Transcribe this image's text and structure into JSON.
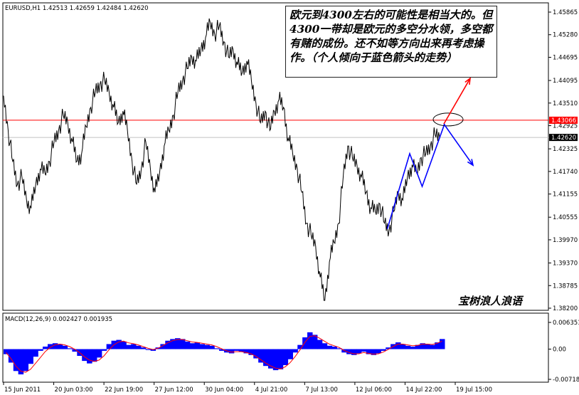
{
  "symbol_header": "EURUSD,H1  1.42513 1.42659 1.42484 1.42620",
  "macd_header": "MACD(12,26,9) 0.002427 0.001935",
  "annotation_text": "欧元到4300左右的可能性是相当大的。但4300一带却是欧元的多空分水领，多空都有赌的成份。还不如等方向出来再考虑操作。（个人倾向于蓝色箭头的走势）",
  "watermark": "宝树浪人浪语",
  "colors": {
    "background": "#ffffff",
    "price_line": "#000000",
    "horizontal_line": "#ff0000",
    "current_price_line": "#c0c0c0",
    "current_price_box": "#000000",
    "macd_histogram": "#0000ff",
    "macd_signal": "#ff0000",
    "arrow_up": "#ff0000",
    "arrow_down": "#0000ff"
  },
  "chart_data": [
    {
      "type": "line",
      "title": "EURUSD,H1",
      "x_tick_labels": [
        "15 Jun 2011",
        "20 Jun 03:00",
        "22 Jun 19:00",
        "27 Jun 12:00",
        "30 Jun 04:00",
        "4 Jul 21:00",
        "7 Jul 13:00",
        "12 Jul 06:00",
        "14 Jul 22:00",
        "19 Jul 15:00"
      ],
      "y_tick_labels": [
        "1.45865",
        "1.45280",
        "1.44695",
        "1.44095",
        "1.43510",
        "1.42925",
        "1.42325",
        "1.41740",
        "1.41155",
        "1.40555",
        "1.39970",
        "1.39370",
        "1.38785",
        "1.38200"
      ],
      "ylim": [
        1.382,
        1.45865
      ],
      "horizontal_line": 1.43066,
      "horizontal_line_label": "1.43066",
      "current_price": 1.4262,
      "current_price_label": "1.42620",
      "series": [
        {
          "values": [
            1.437,
            1.428,
            1.42,
            1.414,
            1.416,
            1.41,
            1.408,
            1.414,
            1.418,
            1.417,
            1.42,
            1.425,
            1.428,
            1.432,
            1.43,
            1.425,
            1.42,
            1.422,
            1.429,
            1.434,
            1.438,
            1.44,
            1.441,
            1.438,
            1.434,
            1.43,
            1.433,
            1.428,
            1.42,
            1.414,
            1.418,
            1.425,
            1.418,
            1.412,
            1.417,
            1.424,
            1.428,
            1.432,
            1.438,
            1.441,
            1.444,
            1.447,
            1.446,
            1.449,
            1.452,
            1.456,
            1.453,
            1.455,
            1.451,
            1.447,
            1.449,
            1.445,
            1.443,
            1.446,
            1.441,
            1.435,
            1.43,
            1.433,
            1.428,
            1.433,
            1.436,
            1.434,
            1.426,
            1.422,
            1.418,
            1.412,
            1.404,
            1.401,
            1.398,
            1.39,
            1.384,
            1.394,
            1.399,
            1.404,
            1.416,
            1.424,
            1.421,
            1.419,
            1.416,
            1.412,
            1.408,
            1.407,
            1.409,
            1.404,
            1.402,
            1.407,
            1.412,
            1.41,
            1.416,
            1.419,
            1.417,
            1.421,
            1.422,
            1.424,
            1.427,
            1.4262
          ]
        }
      ],
      "annotations": {
        "blue_zigzag": [
          [
            1,
            1.4025
          ],
          [
            10,
            1.422
          ],
          [
            15,
            1.4135
          ],
          [
            24,
            1.4297
          ]
        ],
        "red_arrow_target": 1.4415,
        "blue_arrow_target": 1.419,
        "ellipse_level": 1.43066
      }
    },
    {
      "type": "bar",
      "title": "MACD(12,26,9)",
      "y_tick_labels": [
        "0.006351",
        "0.00",
        "-0.00718"
      ],
      "ylim": [
        -0.00718,
        0.006351
      ],
      "series": [
        {
          "name": "MACD",
          "values": [
            -0.0012,
            -0.0032,
            -0.0052,
            -0.006,
            -0.0052,
            -0.0035,
            -0.0018,
            -0.0004,
            0.0006,
            0.0012,
            0.0014,
            0.0012,
            0.0008,
            0.0002,
            -0.0006,
            -0.0016,
            -0.0028,
            -0.0034,
            -0.003,
            -0.002,
            -0.0004,
            0.0012,
            0.002,
            0.0022,
            0.0018,
            0.001,
            0.0012,
            0.0008,
            0.0004,
            -0.0002,
            -0.0004,
            0.0004,
            0.0012,
            0.002,
            0.0024,
            0.0026,
            0.0024,
            0.0018,
            0.0014,
            0.0016,
            0.0012,
            0.001,
            0.0008,
            0.0002,
            -0.0004,
            -0.0008,
            -0.001,
            -0.0004,
            -0.0006,
            -0.001,
            -0.0014,
            -0.0022,
            -0.0032,
            -0.004,
            -0.0046,
            -0.005,
            -0.0048,
            -0.0038,
            -0.0024,
            -0.0008,
            0.001,
            0.0028,
            0.004,
            0.0034,
            0.0022,
            0.0014,
            0.0008,
            0.0006,
            0.0002,
            -0.0008,
            -0.0012,
            -0.0014,
            -0.001,
            -0.0006,
            -0.0012,
            -0.0014,
            -0.001,
            -0.0004,
            0.0004,
            0.0012,
            0.0016,
            0.0012,
            0.0008,
            0.0006,
            0.001,
            0.0014,
            0.0012,
            0.001,
            0.0016,
            0.0024
          ]
        },
        {
          "name": "Signal",
          "values": [
            -0.0008,
            -0.0022,
            -0.004,
            -0.0052,
            -0.0055,
            -0.0048,
            -0.0034,
            -0.002,
            -0.0006,
            0.0004,
            0.001,
            0.0012,
            0.001,
            0.0006,
            0.0,
            -0.0008,
            -0.0018,
            -0.0026,
            -0.0029,
            -0.0026,
            -0.0016,
            -0.0002,
            0.001,
            0.0017,
            0.0019,
            0.0015,
            0.0013,
            0.001,
            0.0006,
            0.0002,
            -0.0001,
            0.0002,
            0.0008,
            0.0015,
            0.002,
            0.0023,
            0.0023,
            0.002,
            0.0017,
            0.0016,
            0.0014,
            0.0012,
            0.001,
            0.0006,
            0.0001,
            -0.0004,
            -0.0007,
            -0.0006,
            -0.0006,
            -0.0008,
            -0.0011,
            -0.0017,
            -0.0025,
            -0.0033,
            -0.004,
            -0.0045,
            -0.0047,
            -0.0042,
            -0.0032,
            -0.0018,
            -0.0002,
            0.0016,
            0.003,
            0.0032,
            0.0026,
            0.0019,
            0.0012,
            0.0008,
            0.0004,
            -0.0003,
            -0.0008,
            -0.0011,
            -0.0011,
            -0.0008,
            -0.001,
            -0.0012,
            -0.0011,
            -0.0007,
            -0.0001,
            0.0006,
            0.0012,
            0.0012,
            0.001,
            0.0008,
            0.0009,
            0.0012,
            0.0012,
            0.0011,
            0.0014,
            0.0019
          ]
        }
      ]
    }
  ]
}
